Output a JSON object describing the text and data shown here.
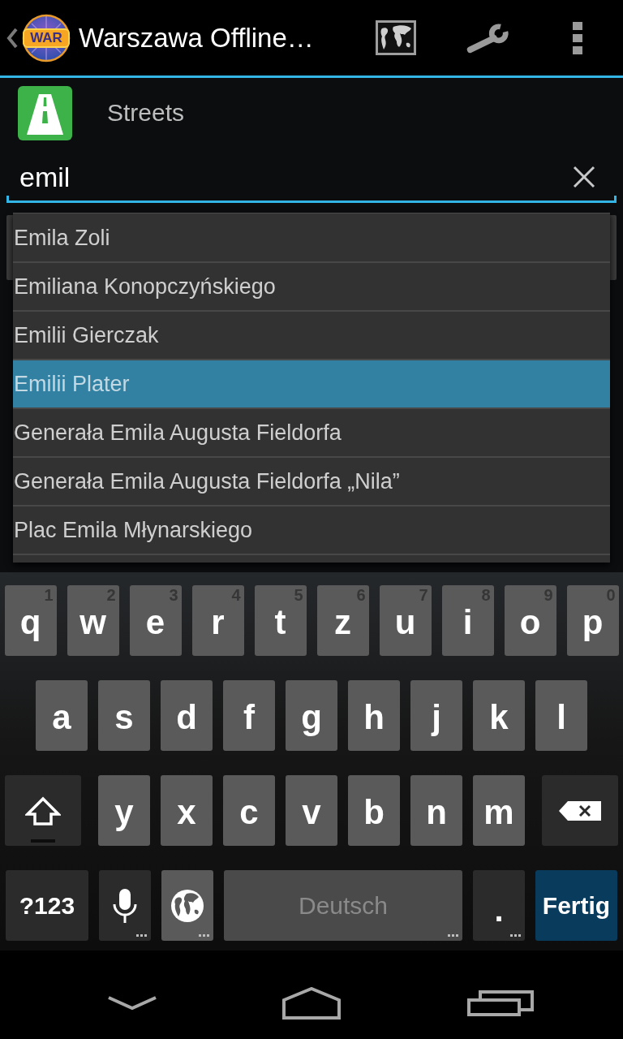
{
  "action_bar": {
    "badge": "WAR",
    "title": "Warszawa Offline…"
  },
  "category": {
    "label": "Streets"
  },
  "search": {
    "value": "emil"
  },
  "suggestions": [
    {
      "text": "Emila Zoli",
      "selected": false
    },
    {
      "text": "Emiliana Konopczyńskiego",
      "selected": false
    },
    {
      "text": "Emilii Gierczak",
      "selected": false
    },
    {
      "text": "Emilii Plater",
      "selected": true
    },
    {
      "text": "Generała Emila Augusta Fieldorfa",
      "selected": false
    },
    {
      "text": "Generała Emila Augusta Fieldorfa „Nila”",
      "selected": false
    },
    {
      "text": "Plac Emila Młynarskiego",
      "selected": false
    }
  ],
  "keyboard": {
    "rows": [
      {
        "keys": [
          {
            "kind": "letter",
            "label": "q",
            "hint": "1",
            "more_keys": false
          },
          {
            "kind": "letter",
            "label": "w",
            "hint": "2",
            "more_keys": false
          },
          {
            "kind": "letter",
            "label": "e",
            "hint": "3",
            "more_keys": false
          },
          {
            "kind": "letter",
            "label": "r",
            "hint": "4",
            "more_keys": false
          },
          {
            "kind": "letter",
            "label": "t",
            "hint": "5",
            "more_keys": false
          },
          {
            "kind": "letter",
            "label": "z",
            "hint": "6",
            "more_keys": false
          },
          {
            "kind": "letter",
            "label": "u",
            "hint": "7",
            "more_keys": false
          },
          {
            "kind": "letter",
            "label": "i",
            "hint": "8",
            "more_keys": false
          },
          {
            "kind": "letter",
            "label": "o",
            "hint": "9",
            "more_keys": false
          },
          {
            "kind": "letter",
            "label": "p",
            "hint": "0",
            "more_keys": false
          }
        ]
      },
      {
        "keys": [
          {
            "kind": "letter",
            "label": "a",
            "more_keys": false
          },
          {
            "kind": "letter",
            "label": "s",
            "more_keys": false
          },
          {
            "kind": "letter",
            "label": "d",
            "more_keys": false
          },
          {
            "kind": "letter",
            "label": "f",
            "more_keys": false
          },
          {
            "kind": "letter",
            "label": "g",
            "more_keys": false
          },
          {
            "kind": "letter",
            "label": "h",
            "more_keys": false
          },
          {
            "kind": "letter",
            "label": "j",
            "more_keys": false
          },
          {
            "kind": "letter",
            "label": "k",
            "more_keys": false
          },
          {
            "kind": "letter",
            "label": "l",
            "more_keys": false
          }
        ]
      },
      {
        "keys": [
          {
            "kind": "shift",
            "more_keys": false
          },
          {
            "kind": "letter",
            "label": "y",
            "more_keys": false
          },
          {
            "kind": "letter",
            "label": "x",
            "more_keys": false
          },
          {
            "kind": "letter",
            "label": "c",
            "more_keys": false
          },
          {
            "kind": "letter",
            "label": "v",
            "more_keys": false
          },
          {
            "kind": "letter",
            "label": "b",
            "more_keys": false
          },
          {
            "kind": "letter",
            "label": "n",
            "more_keys": false
          },
          {
            "kind": "letter",
            "label": "m",
            "more_keys": false
          },
          {
            "kind": "backspace",
            "more_keys": false
          }
        ]
      },
      {
        "keys": [
          {
            "kind": "symbols",
            "label": "?123",
            "more_keys": false
          },
          {
            "kind": "mic",
            "more_keys": true
          },
          {
            "kind": "language",
            "more_keys": true
          },
          {
            "kind": "space",
            "label": "Deutsch",
            "more_keys": true
          },
          {
            "kind": "period",
            "label": ".",
            "more_keys": true
          },
          {
            "kind": "action",
            "label": "Fertig",
            "more_keys": false
          }
        ]
      }
    ]
  }
}
